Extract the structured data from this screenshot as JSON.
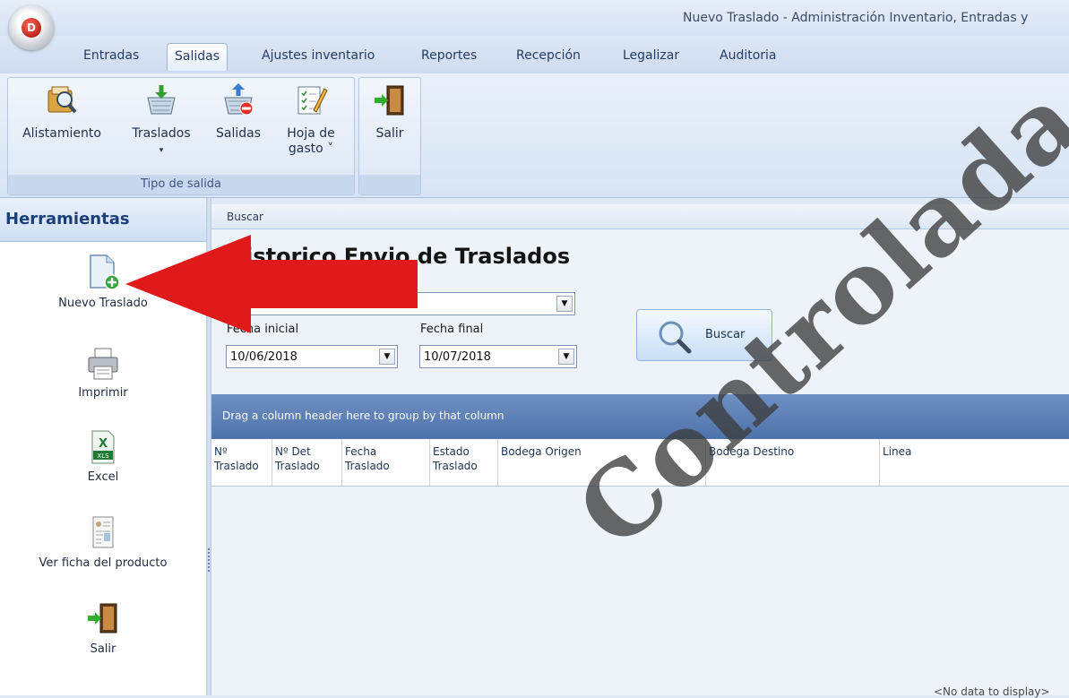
{
  "window": {
    "title": "Nuevo Traslado - Administración Inventario, Entradas y",
    "orb_letter": "D"
  },
  "ribbon": {
    "tabs": [
      {
        "label": "Entradas"
      },
      {
        "label": "Salidas",
        "active": true
      },
      {
        "label": "Ajustes inventario"
      },
      {
        "label": "Reportes"
      },
      {
        "label": "Recepción"
      },
      {
        "label": "Legalizar"
      },
      {
        "label": "Auditoria"
      }
    ],
    "group_tipo_salida": {
      "caption": "Tipo de salida",
      "buttons": {
        "alistamiento": "Alistamiento",
        "traslados": "Traslados",
        "salidas": "Salidas",
        "hoja_de_gasto_line1": "Hoja de",
        "hoja_de_gasto_line2": "gasto ˅"
      }
    },
    "group_salir": {
      "salir": "Salir"
    }
  },
  "left_panel": {
    "title": "Herramientas",
    "tools": {
      "nuevo_traslado": "Nuevo Traslado",
      "imprimir": "Imprimir",
      "excel": "Excel",
      "excel_badge": "XLS",
      "ver_ficha": "Ver ficha del producto",
      "salir": "Salir"
    }
  },
  "main": {
    "search_header": "Buscar",
    "page_title": "Historico Envio de Traslados",
    "fecha_inicial": {
      "label": "Fecha inicial",
      "value": "10/06/2018"
    },
    "fecha_final": {
      "label": "Fecha final",
      "value": "10/07/2018"
    },
    "buscar_button": "Buscar",
    "grid": {
      "group_hint": "Drag a column header here to group by that column",
      "columns": {
        "n_traslado": [
          "Nº",
          "Traslado"
        ],
        "n_det_traslado": [
          "Nº Det",
          "Traslado"
        ],
        "fecha_traslado": [
          "Fecha",
          "Traslado"
        ],
        "estado_traslado": [
          "Estado",
          "Traslado"
        ],
        "bodega_origen": "Bodega Origen",
        "bodega_destino": "Bodega Destino",
        "linea": "Linea"
      },
      "empty_text": "<No data to display>"
    }
  },
  "watermark": "Controlada",
  "colors": {
    "accent_red": "#e01a1a",
    "grid_group_panel": "#5a7db5",
    "header_blue": "#1a3f7a"
  }
}
